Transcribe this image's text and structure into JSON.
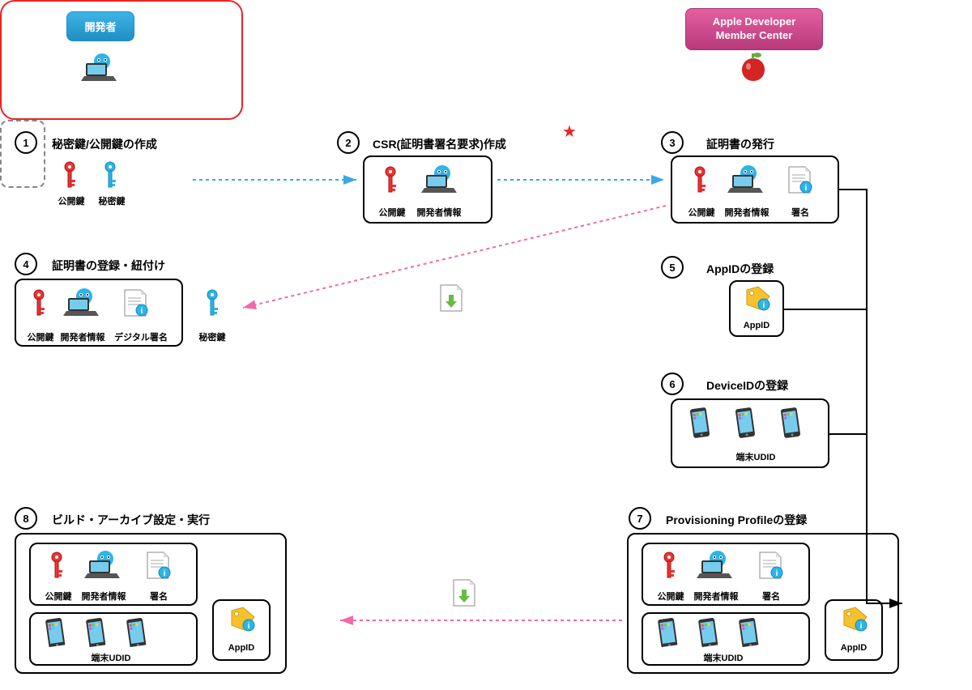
{
  "header": {
    "left_badge": "開発者",
    "right_badge": "Apple Developer\nMember Center"
  },
  "steps": {
    "s1": {
      "num": "1",
      "title": "秘密鍵/公開鍵の作成"
    },
    "s2": {
      "num": "2",
      "title": "CSR(証明書署名要求)作成"
    },
    "s3": {
      "num": "3",
      "title": "証明書の発行"
    },
    "s4": {
      "num": "4",
      "title": "証明書の登録・紐付け"
    },
    "s5": {
      "num": "5",
      "title": "AppIDの登録"
    },
    "s6": {
      "num": "6",
      "title": "DeviceIDの登録"
    },
    "s7": {
      "num": "7",
      "title": "Provisioning Profileの登録"
    },
    "s8": {
      "num": "8",
      "title": "ビルド・アーカイブ設定・実行"
    }
  },
  "labels": {
    "pubkey": "公開鍵",
    "privkey": "秘密鍵",
    "devinfo": "開発者情報",
    "signature": "署名",
    "digital_signature": "デジタル署名",
    "appid": "AppID",
    "udid": "端末UDID"
  },
  "colors": {
    "blue_arrow": "#39a9e0",
    "pink_arrow": "#f06aa8",
    "black": "#000"
  }
}
